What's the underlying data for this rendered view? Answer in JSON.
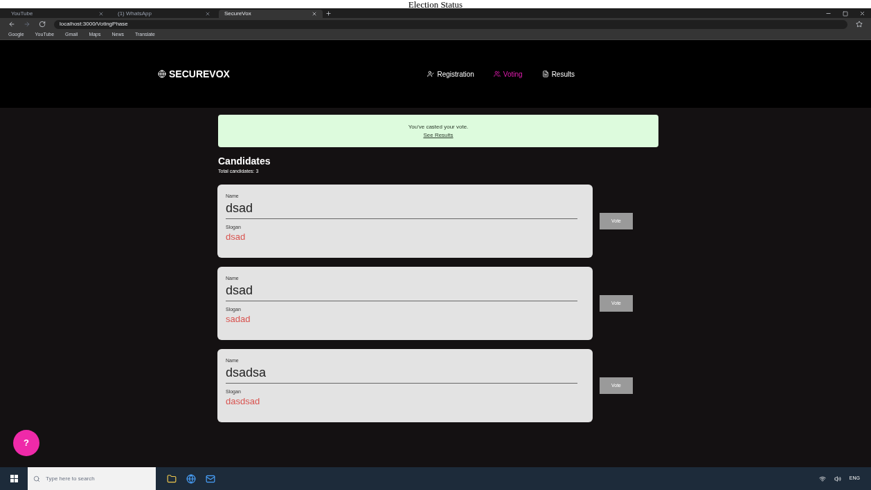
{
  "caption": "Election Status",
  "browser": {
    "tabs": [
      {
        "label": "YouTube",
        "selected": false
      },
      {
        "label": "(1) WhatsApp",
        "selected": false
      },
      {
        "label": "SecureVox",
        "selected": true
      }
    ],
    "url": "localhost:3000/VotingPhase",
    "bookmarks": [
      "Google",
      "YouTube",
      "Gmail",
      "Maps",
      "News",
      "Translate"
    ]
  },
  "app": {
    "brand": "SECUREVOX",
    "nav": [
      {
        "label": "Registration",
        "selected": false
      },
      {
        "label": "Voting",
        "selected": true
      },
      {
        "label": "Results",
        "selected": false
      }
    ],
    "alert": {
      "message": "You've casted your vote.",
      "link": "See Results"
    },
    "heading": "Candidates",
    "subheading": "Total candidates: 3",
    "candidates": [
      {
        "name_label": "Name",
        "name": "dsad",
        "slogan_label": "Slogan",
        "slogan": "dsad",
        "button": "Vote",
        "disabled": true
      },
      {
        "name_label": "Name",
        "name": "dsad",
        "slogan_label": "Slogan",
        "slogan": "sadad",
        "button": "Vote",
        "disabled": true
      },
      {
        "name_label": "Name",
        "name": "dsadsa",
        "slogan_label": "Slogan",
        "slogan": "dasdsad",
        "button": "Vote",
        "disabled": true
      }
    ],
    "help": "?"
  },
  "taskbar": {
    "search_placeholder": "Type here to search",
    "language": "ENG"
  }
}
